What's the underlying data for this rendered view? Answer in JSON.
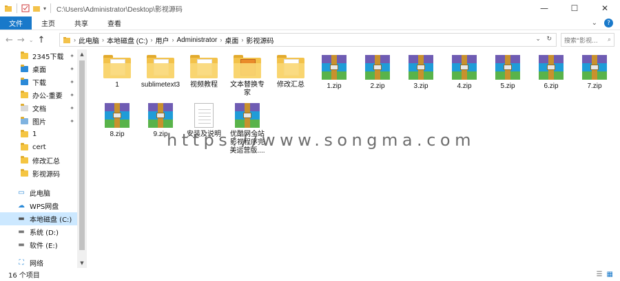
{
  "window": {
    "title": "C:\\Users\\Administrator\\Desktop\\影视源码",
    "controls": [
      "—",
      "☐",
      "✕"
    ]
  },
  "ribbon": {
    "tabs": [
      "文件",
      "主页",
      "共享",
      "查看"
    ]
  },
  "address": {
    "crumbs": [
      "此电脑",
      "本地磁盘 (C:)",
      "用户",
      "Administrator",
      "桌面",
      "影视源码"
    ],
    "search_placeholder": "搜索\"影视..."
  },
  "sidebar": {
    "items": [
      {
        "label": "2345下载",
        "pinned": true
      },
      {
        "label": "桌面",
        "pinned": true
      },
      {
        "label": "下载",
        "pinned": true
      },
      {
        "label": "办公-重要",
        "pinned": true
      },
      {
        "label": "文档",
        "pinned": true
      },
      {
        "label": "图片",
        "pinned": true
      },
      {
        "label": "1",
        "pinned": false
      },
      {
        "label": "cert",
        "pinned": false
      },
      {
        "label": "修改汇总",
        "pinned": false
      },
      {
        "label": "影视源码",
        "pinned": false
      },
      {
        "label": "此电脑"
      },
      {
        "label": "WPS网盘"
      },
      {
        "label": "本地磁盘 (C:)",
        "selected": true
      },
      {
        "label": "系统 (D:)"
      },
      {
        "label": "软件 (E:)"
      },
      {
        "label": "网络"
      }
    ]
  },
  "files": [
    {
      "name": "1",
      "type": "folder"
    },
    {
      "name": "sublimetext3",
      "type": "folder"
    },
    {
      "name": "视频教程",
      "type": "folder"
    },
    {
      "name": "文本替换专家",
      "type": "folder"
    },
    {
      "name": "修改汇总",
      "type": "folder"
    },
    {
      "name": "1.zip",
      "type": "zip"
    },
    {
      "name": "2.zip",
      "type": "zip"
    },
    {
      "name": "3.zip",
      "type": "zip"
    },
    {
      "name": "4.zip",
      "type": "zip"
    },
    {
      "name": "5.zip",
      "type": "zip"
    },
    {
      "name": "6.zip",
      "type": "zip"
    },
    {
      "name": "7.zip",
      "type": "zip"
    },
    {
      "name": "8.zip",
      "type": "zip"
    },
    {
      "name": "9.zip",
      "type": "zip"
    },
    {
      "name": "安装及说明",
      "type": "doc"
    },
    {
      "name": "优酷网全站 影视程序完美运营版....",
      "type": "zip"
    }
  ],
  "watermark": "https://www.songma.com",
  "status": {
    "count": "16 个项目"
  }
}
